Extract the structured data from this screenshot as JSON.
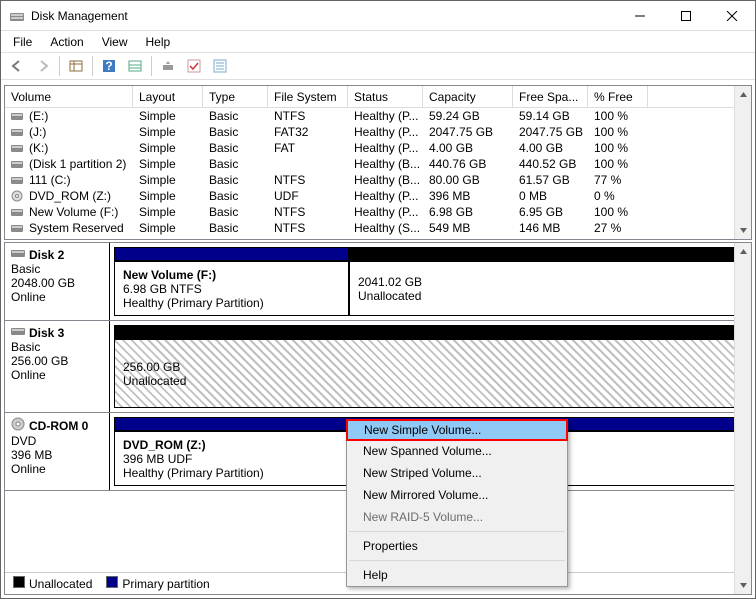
{
  "window": {
    "title": "Disk Management"
  },
  "menu": {
    "file": "File",
    "action": "Action",
    "view": "View",
    "help": "Help"
  },
  "columns": {
    "volume": "Volume",
    "layout": "Layout",
    "type": "Type",
    "filesystem": "File System",
    "status": "Status",
    "capacity": "Capacity",
    "freespace": "Free Spa...",
    "pctfree": "% Free"
  },
  "volumes": [
    {
      "name": "(E:)",
      "layout": "Simple",
      "type": "Basic",
      "fs": "NTFS",
      "status": "Healthy (P...",
      "cap": "59.24 GB",
      "free": "59.14 GB",
      "pct": "100 %"
    },
    {
      "name": "(J:)",
      "layout": "Simple",
      "type": "Basic",
      "fs": "FAT32",
      "status": "Healthy (P...",
      "cap": "2047.75 GB",
      "free": "2047.75 GB",
      "pct": "100 %"
    },
    {
      "name": "(K:)",
      "layout": "Simple",
      "type": "Basic",
      "fs": "FAT",
      "status": "Healthy (P...",
      "cap": "4.00 GB",
      "free": "4.00 GB",
      "pct": "100 %"
    },
    {
      "name": "(Disk 1 partition 2)",
      "layout": "Simple",
      "type": "Basic",
      "fs": "",
      "status": "Healthy (B...",
      "cap": "440.76 GB",
      "free": "440.52 GB",
      "pct": "100 %"
    },
    {
      "name": "111 (C:)",
      "layout": "Simple",
      "type": "Basic",
      "fs": "NTFS",
      "status": "Healthy (B...",
      "cap": "80.00 GB",
      "free": "61.57 GB",
      "pct": "77 %"
    },
    {
      "name": "DVD_ROM (Z:)",
      "layout": "Simple",
      "type": "Basic",
      "fs": "UDF",
      "status": "Healthy (P...",
      "cap": "396 MB",
      "free": "0 MB",
      "pct": "0 %"
    },
    {
      "name": "New Volume (F:)",
      "layout": "Simple",
      "type": "Basic",
      "fs": "NTFS",
      "status": "Healthy (P...",
      "cap": "6.98 GB",
      "free": "6.95 GB",
      "pct": "100 %"
    },
    {
      "name": "System Reserved",
      "layout": "Simple",
      "type": "Basic",
      "fs": "NTFS",
      "status": "Healthy (S...",
      "cap": "549 MB",
      "free": "146 MB",
      "pct": "27 %"
    }
  ],
  "disks": {
    "d2": {
      "name": "Disk 2",
      "type": "Basic",
      "size": "2048.00 GB",
      "state": "Online",
      "p1_name": "New Volume  (F:)",
      "p1_sub": "6.98 GB NTFS",
      "p1_health": "Healthy (Primary Partition)",
      "p2_size": "2041.02 GB",
      "p2_state": "Unallocated"
    },
    "d3": {
      "name": "Disk 3",
      "type": "Basic",
      "size": "256.00 GB",
      "state": "Online",
      "p1_size": "256.00 GB",
      "p1_state": "Unallocated"
    },
    "cd": {
      "name": "CD-ROM 0",
      "type": "DVD",
      "size": "396 MB",
      "state": "Online",
      "p1_name": "DVD_ROM  (Z:)",
      "p1_sub": "396 MB UDF",
      "p1_health": "Healthy (Primary Partition)"
    }
  },
  "legend": {
    "unalloc": "Unallocated",
    "primary": "Primary partition"
  },
  "context": {
    "simple": "New Simple Volume...",
    "spanned": "New Spanned Volume...",
    "striped": "New Striped Volume...",
    "mirrored": "New Mirrored Volume...",
    "raid5": "New RAID-5 Volume...",
    "props": "Properties",
    "help": "Help"
  },
  "col_widths": {
    "volume": 128,
    "layout": 70,
    "type": 65,
    "fs": 80,
    "status": 75,
    "cap": 90,
    "free": 75,
    "pct": 60
  }
}
